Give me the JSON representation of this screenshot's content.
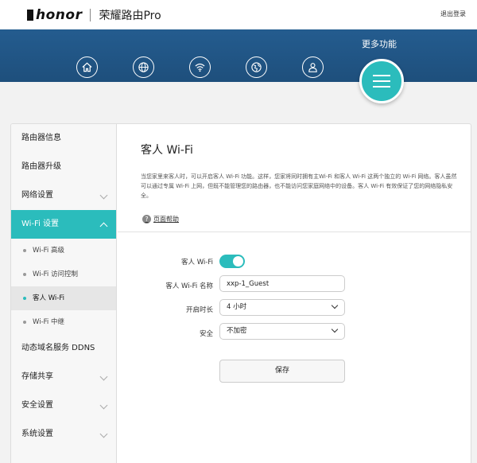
{
  "header": {
    "brand": "honor",
    "product": "荣耀路由Pro",
    "logout": "退出登录"
  },
  "nav": {
    "icons": [
      "home-icon",
      "internet-icon",
      "wifi-icon",
      "network-icon",
      "user-icon"
    ],
    "more_label": "更多功能"
  },
  "sidebar": {
    "items": [
      {
        "label": "路由器信息"
      },
      {
        "label": "路由器升级"
      },
      {
        "label": "网络设置"
      },
      {
        "label": "Wi-Fi 设置"
      },
      {
        "label": "动态域名服务 DDNS"
      },
      {
        "label": "存储共享"
      },
      {
        "label": "安全设置"
      },
      {
        "label": "系统设置"
      }
    ],
    "wifi_sub": [
      {
        "label": "Wi-Fi 高级"
      },
      {
        "label": "Wi-Fi 访问控制"
      },
      {
        "label": "客人 Wi-Fi"
      },
      {
        "label": "Wi-Fi 中继"
      }
    ]
  },
  "main": {
    "title": "客人 Wi-Fi",
    "description": "当您家里来客人时，可以开启客人 Wi-Fi 功能。这样，您家将同时拥有主Wi-Fi 和客人 Wi-Fi 这两个独立的 Wi-Fi 网络。客人虽然可以通过专属 Wi-Fi 上网，但既不能管理您的路由器，也不能访问您家庭网络中的设备。客人 Wi-Fi 有效保证了您的网络隐私安全。",
    "help": "页面帮助",
    "form": {
      "toggle_label": "客人 Wi-Fi",
      "toggle_on": true,
      "name_label": "客人 Wi-Fi 名称",
      "name_value": "xxp-1_Guest",
      "duration_label": "开启时长",
      "duration_value": "4 小时",
      "security_label": "安全",
      "security_value": "不加密",
      "save_label": "保存"
    }
  },
  "colors": {
    "accent": "#2bbcbc",
    "nav_bg": "#245c8f"
  }
}
